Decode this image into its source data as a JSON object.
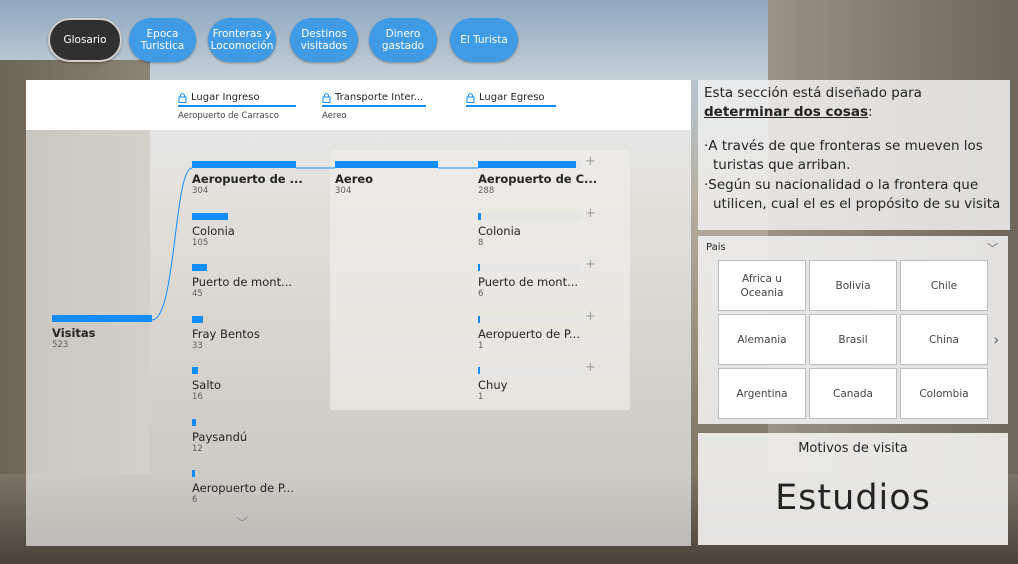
{
  "nav": {
    "buttons": [
      "Glosario",
      "Epoca\nTuristica",
      "Fronteras y\nLocomoción",
      "Destinos\nvisitados",
      "Dinero\ngastado",
      "El Turista"
    ]
  },
  "tree": {
    "levels": [
      {
        "title": "Lugar Ingreso",
        "value": "Aeropuerto de Carrasco"
      },
      {
        "title": "Transporte Inter...",
        "value": "Aereo"
      },
      {
        "title": "Lugar Egreso",
        "value": ""
      }
    ],
    "root": {
      "name": "Visitas",
      "count": "523"
    },
    "col1": [
      {
        "name": "Aeropuerto de ...",
        "count": "304",
        "frac": 1.0
      },
      {
        "name": "Colonia",
        "count": "105",
        "frac": 0.345
      },
      {
        "name": "Puerto de mont...",
        "count": "45",
        "frac": 0.148
      },
      {
        "name": "Fray Bentos",
        "count": "33",
        "frac": 0.109
      },
      {
        "name": "Salto",
        "count": "16",
        "frac": 0.053
      },
      {
        "name": "Paysandú",
        "count": "12",
        "frac": 0.039
      },
      {
        "name": "Aeropuerto de P...",
        "count": "6",
        "frac": 0.02
      }
    ],
    "col2": [
      {
        "name": "Aereo",
        "count": "304",
        "frac": 1.0
      }
    ],
    "col3": [
      {
        "name": "Aeropuerto de C...",
        "count": "288",
        "frac": 0.947
      },
      {
        "name": "Colonia",
        "count": "8",
        "frac": 0.026
      },
      {
        "name": "Puerto de mont...",
        "count": "6",
        "frac": 0.02
      },
      {
        "name": "Aeropuerto de P...",
        "count": "1",
        "frac": 0.003
      },
      {
        "name": "Chuy",
        "count": "1",
        "frac": 0.003
      }
    ]
  },
  "info": {
    "line1": "Esta sección está diseñado para ",
    "bold": "determinar dos cosas",
    "line1_end": ":",
    "bullets": [
      "A través de que fronteras se mueven los turistas que arriban.",
      "Según su nacionalidad o la frontera que utilicen, cual el es el propósito de su visita"
    ]
  },
  "slicer": {
    "title": "Pais",
    "items": [
      "Africa u\nOceania",
      "Bolivia",
      "Chile",
      "Alemania",
      "Brasil",
      "China",
      "Argentina",
      "Canada",
      "Colombia"
    ]
  },
  "card": {
    "title": "Motivos de visita",
    "value": "Estudios"
  },
  "colors": {
    "accent": "#118dff",
    "nav": "#3f9be6",
    "nav_selected": "#303030"
  },
  "icons": [
    "lock-icon",
    "plus-icon",
    "chevron-down-icon",
    "chevron-right-icon"
  ]
}
